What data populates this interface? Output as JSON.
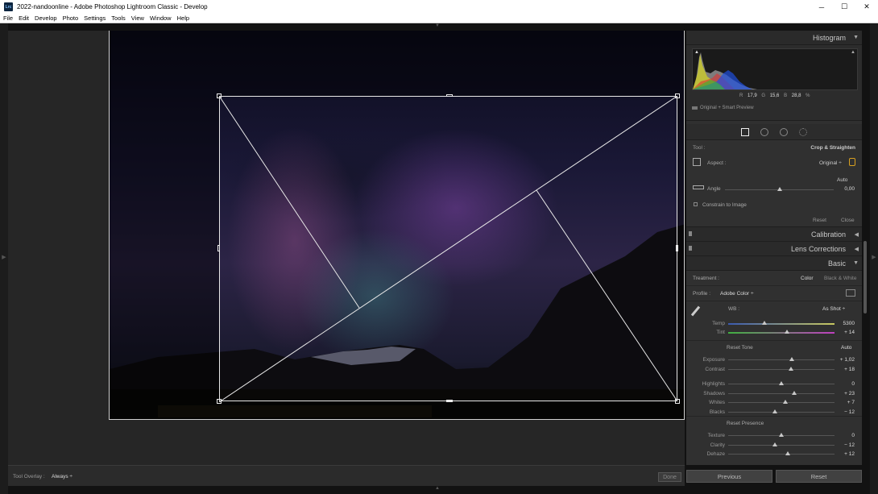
{
  "window": {
    "app_icon": "Lrc",
    "title": "2022-nandoonline - Adobe Photoshop Lightroom Classic - Develop",
    "minimize": "─",
    "maximize": "☐",
    "close": "✕"
  },
  "menu": [
    "File",
    "Edit",
    "Develop",
    "Photo",
    "Settings",
    "Tools",
    "View",
    "Window",
    "Help"
  ],
  "toolbar": {
    "overlay_label": "Tool Overlay :",
    "overlay_value": "Always ÷",
    "done_label": "Done"
  },
  "histogram": {
    "title": "Histogram",
    "r_label": "R",
    "r_value": "17,9",
    "g_label": "G",
    "g_value": "15,6",
    "b_label": "B",
    "b_value": "28,8",
    "pct": "%",
    "preview_label": "Original + Smart Preview"
  },
  "crop": {
    "tool_label": "Tool :",
    "tool_name": "Crop & Straighten",
    "aspect_label": "Aspect :",
    "aspect_value": "Original ÷",
    "auto_label": "Auto",
    "angle_label": "Angle",
    "angle_value": "0,00",
    "angle_level": 0.5,
    "constrain_label": "Constrain to Image",
    "reset_label": "Reset",
    "close_label": "Close"
  },
  "panels": {
    "calibration": "Calibration",
    "lens": "Lens Corrections",
    "basic": "Basic"
  },
  "basic": {
    "treatment_label": "Treatment :",
    "color_label": "Color",
    "bw_label": "Black & White",
    "profile_label": "Profile :",
    "profile_value": "Adobe Color ÷",
    "wb_label": "WB :",
    "wb_value": "As Shot ÷",
    "temp_label": "Temp",
    "temp_value": "5300",
    "temp_level": 0.34,
    "tint_label": "Tint",
    "tint_value": "+ 14",
    "tint_level": 0.55,
    "reset_tone": "Reset Tone",
    "auto": "Auto",
    "reset_presence": "Reset Presence",
    "tone": [
      {
        "label": "Exposure",
        "value": "+ 1,02",
        "level": 0.6
      },
      {
        "label": "Contrast",
        "value": "+ 18",
        "level": 0.59
      },
      {
        "label": "Highlights",
        "value": "0",
        "level": 0.5
      },
      {
        "label": "Shadows",
        "value": "+ 23",
        "level": 0.62
      },
      {
        "label": "Whites",
        "value": "+ 7",
        "level": 0.54
      },
      {
        "label": "Blacks",
        "value": "− 12",
        "level": 0.44
      }
    ],
    "presence": [
      {
        "label": "Texture",
        "value": "0",
        "level": 0.5
      },
      {
        "label": "Clarity",
        "value": "− 12",
        "level": 0.44
      },
      {
        "label": "Dehaze",
        "value": "+ 12",
        "level": 0.56
      }
    ]
  },
  "bottom": {
    "previous": "Previous",
    "reset": "Reset"
  }
}
